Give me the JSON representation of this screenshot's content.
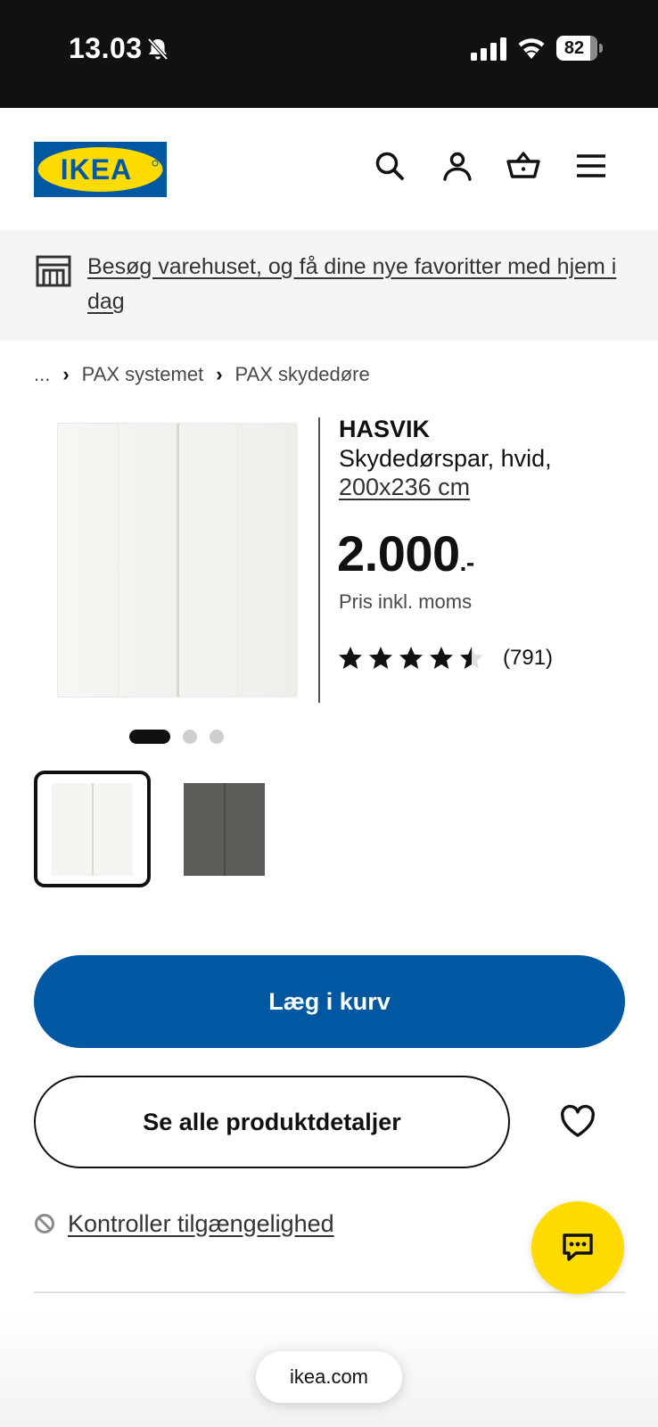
{
  "status_bar": {
    "time": "13.03",
    "battery": "82",
    "icons": [
      "bell-muted-icon",
      "cellular-signal-icon",
      "wifi-icon",
      "battery-icon"
    ]
  },
  "header": {
    "logo_text": "IKEA",
    "logo_colors": {
      "blue": "#0058a3",
      "yellow": "#ffdb00"
    },
    "icons": [
      "search-icon",
      "account-icon",
      "basket-icon",
      "menu-icon"
    ]
  },
  "banner": {
    "icon": "store-icon",
    "text": "Besøg varehuset, og få dine nye favoritter med hjem i dag"
  },
  "breadcrumb": {
    "items": [
      "...",
      "PAX systemet",
      "PAX skydedøre"
    ]
  },
  "product": {
    "name": "HASVIK",
    "description": "Skydedørspar, hvid,",
    "size": "200x236 cm",
    "price": "2.000",
    "price_suffix": ".-",
    "vat_note": "Pris inkl. moms",
    "rating": 4.5,
    "rating_max": 5,
    "review_count": "(791)"
  },
  "gallery": {
    "image_count": 3,
    "active_index": 0,
    "thumbnails": [
      {
        "name": "white",
        "color": "#f4f4f1",
        "selected": true
      },
      {
        "name": "dark-grey",
        "color": "#5e5c59",
        "selected": false
      }
    ]
  },
  "actions": {
    "add_to_cart": "Læg i kurv",
    "see_details": "Se alle produktdetaljer",
    "check_availability": "Kontroller tilgængelighed"
  },
  "browser": {
    "url": "ikea.com"
  },
  "colors": {
    "primary": "#0058a3",
    "chat": "#ffdb00",
    "banner_bg": "#f5f5f5"
  }
}
